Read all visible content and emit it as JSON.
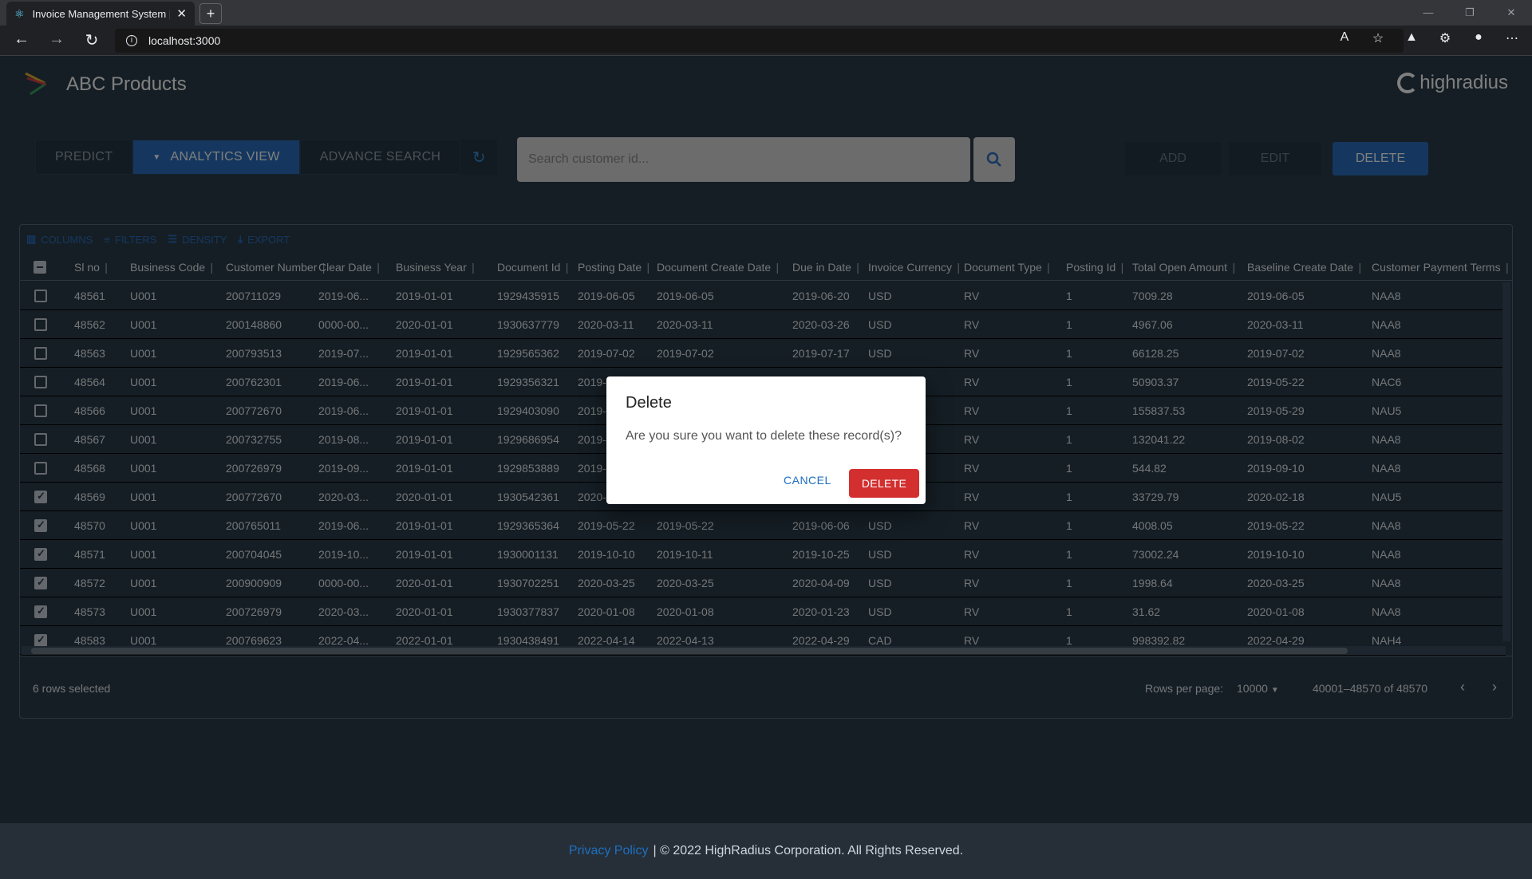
{
  "browser": {
    "tab_title": "Invoice Management System | Hi",
    "url": "localhost:3000"
  },
  "header": {
    "brand": "ABC Products",
    "partner_logo": "highradius"
  },
  "toolbar": {
    "predict": "PREDICT",
    "analytics": "ANALYTICS VIEW",
    "advance_search": "ADVANCE SEARCH",
    "add": "ADD",
    "edit": "EDIT",
    "delete": "DELETE"
  },
  "search": {
    "placeholder": "Search customer id..."
  },
  "grid_tools": {
    "columns": "COLUMNS",
    "filters": "FILTERS",
    "density": "DENSITY",
    "export": "EXPORT"
  },
  "columns": [
    "Sl no",
    "Business Code",
    "Customer Number",
    "Clear Date",
    "Business Year",
    "Document Id",
    "Posting Date",
    "Document Create Date",
    "Due in Date",
    "Invoice Currency",
    "Document Type",
    "Posting Id",
    "Total Open Amount",
    "Baseline Create Date",
    "Customer Payment Terms"
  ],
  "rows": [
    {
      "checked": false,
      "cells": [
        "48561",
        "U001",
        "200711029",
        "2019-06...",
        "2019-01-01",
        "1929435915",
        "2019-06-05",
        "2019-06-05",
        "2019-06-20",
        "USD",
        "RV",
        "1",
        "7009.28",
        "2019-06-05",
        "NAA8"
      ]
    },
    {
      "checked": false,
      "cells": [
        "48562",
        "U001",
        "200148860",
        "0000-00...",
        "2020-01-01",
        "1930637779",
        "2020-03-11",
        "2020-03-11",
        "2020-03-26",
        "USD",
        "RV",
        "1",
        "4967.06",
        "2020-03-11",
        "NAA8"
      ]
    },
    {
      "checked": false,
      "cells": [
        "48563",
        "U001",
        "200793513",
        "2019-07...",
        "2019-01-01",
        "1929565362",
        "2019-07-02",
        "2019-07-02",
        "2019-07-17",
        "USD",
        "RV",
        "1",
        "66128.25",
        "2019-07-02",
        "NAA8"
      ]
    },
    {
      "checked": false,
      "cells": [
        "48564",
        "U001",
        "200762301",
        "2019-06...",
        "2019-01-01",
        "1929356321",
        "2019-0",
        "",
        "",
        "",
        "RV",
        "1",
        "50903.37",
        "2019-05-22",
        "NAC6"
      ]
    },
    {
      "checked": false,
      "cells": [
        "48566",
        "U001",
        "200772670",
        "2019-06...",
        "2019-01-01",
        "1929403090",
        "2019-0",
        "",
        "",
        "",
        "RV",
        "1",
        "155837.53",
        "2019-05-29",
        "NAU5"
      ]
    },
    {
      "checked": false,
      "cells": [
        "48567",
        "U001",
        "200732755",
        "2019-08...",
        "2019-01-01",
        "1929686954",
        "2019-0",
        "",
        "",
        "",
        "RV",
        "1",
        "132041.22",
        "2019-08-02",
        "NAA8"
      ]
    },
    {
      "checked": false,
      "cells": [
        "48568",
        "U001",
        "200726979",
        "2019-09...",
        "2019-01-01",
        "1929853889",
        "2019-0",
        "",
        "",
        "",
        "RV",
        "1",
        "544.82",
        "2019-09-10",
        "NAA8"
      ]
    },
    {
      "checked": true,
      "cells": [
        "48569",
        "U001",
        "200772670",
        "2020-03...",
        "2020-01-01",
        "1930542361",
        "2020-02-18",
        "2020-02-18",
        "2020-03-04",
        "USD",
        "RV",
        "1",
        "33729.79",
        "2020-02-18",
        "NAU5"
      ]
    },
    {
      "checked": true,
      "cells": [
        "48570",
        "U001",
        "200765011",
        "2019-06...",
        "2019-01-01",
        "1929365364",
        "2019-05-22",
        "2019-05-22",
        "2019-06-06",
        "USD",
        "RV",
        "1",
        "4008.05",
        "2019-05-22",
        "NAA8"
      ]
    },
    {
      "checked": true,
      "cells": [
        "48571",
        "U001",
        "200704045",
        "2019-10...",
        "2019-01-01",
        "1930001131",
        "2019-10-10",
        "2019-10-11",
        "2019-10-25",
        "USD",
        "RV",
        "1",
        "73002.24",
        "2019-10-10",
        "NAA8"
      ]
    },
    {
      "checked": true,
      "cells": [
        "48572",
        "U001",
        "200900909",
        "0000-00...",
        "2020-01-01",
        "1930702251",
        "2020-03-25",
        "2020-03-25",
        "2020-04-09",
        "USD",
        "RV",
        "1",
        "1998.64",
        "2020-03-25",
        "NAA8"
      ]
    },
    {
      "checked": true,
      "cells": [
        "48573",
        "U001",
        "200726979",
        "2020-03...",
        "2020-01-01",
        "1930377837",
        "2020-01-08",
        "2020-01-08",
        "2020-01-23",
        "USD",
        "RV",
        "1",
        "31.62",
        "2020-01-08",
        "NAA8"
      ]
    },
    {
      "checked": true,
      "cells": [
        "48583",
        "U001",
        "200769623",
        "2022-04...",
        "2022-01-01",
        "1930438491",
        "2022-04-14",
        "2022-04-13",
        "2022-04-29",
        "CAD",
        "RV",
        "1",
        "998392.82",
        "2022-04-29",
        "NAH4"
      ]
    }
  ],
  "footer_grid": {
    "selected": "6 rows selected",
    "rows_per_page_label": "Rows per page:",
    "rows_per_page": "10000",
    "range": "40001–48570 of 48570"
  },
  "dialog": {
    "title": "Delete",
    "message": "Are you sure you want to delete these record(s)?",
    "cancel": "CANCEL",
    "confirm": "DELETE"
  },
  "footer": {
    "privacy": "Privacy Policy",
    "copyright": "| © 2022 HighRadius Corporation. All Rights Reserved."
  },
  "colors": {
    "background": "#2b3d4b",
    "accent": "#2a6fbf",
    "danger": "#d32f2f"
  }
}
